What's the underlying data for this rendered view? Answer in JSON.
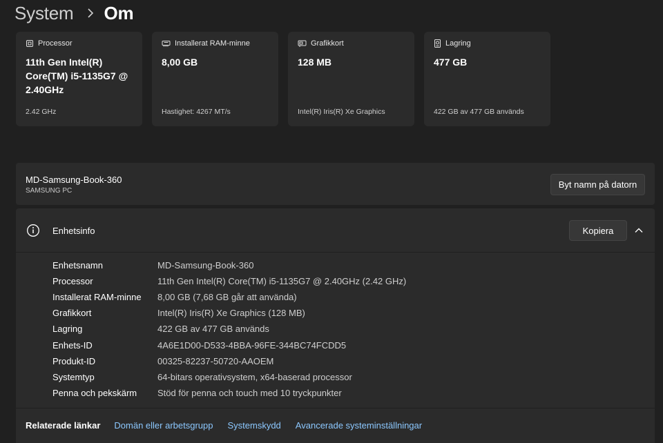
{
  "breadcrumb": {
    "parent": "System",
    "separator_icon": "chevron-right-icon",
    "current": "Om"
  },
  "cards": [
    {
      "title": "Processor",
      "icon": "cpu-icon",
      "value": "11th Gen Intel(R) Core(TM) i5-1135G7 @ 2.40GHz",
      "sub": "2.42 GHz"
    },
    {
      "title": "Installerat RAM-minne",
      "icon": "memory-icon",
      "value": "8,00 GB",
      "sub": "Hastighet: 4267 MT/s"
    },
    {
      "title": "Grafikkort",
      "icon": "gpu-icon",
      "value": "128 MB",
      "sub": "Intel(R) Iris(R) Xe Graphics"
    },
    {
      "title": "Lagring",
      "icon": "storage-icon",
      "value": "477 GB",
      "sub": "422 GB av 477 GB används"
    }
  ],
  "device": {
    "name": "MD-Samsung-Book-360",
    "model": "SAMSUNG PC",
    "rename_label": "Byt namn på datorn"
  },
  "device_info": {
    "title": "Enhetsinfo",
    "icon": "info-icon",
    "copy_label": "Kopiera",
    "collapse_icon": "chevron-up-icon",
    "rows": [
      {
        "label": "Enhetsnamn",
        "value": "MD-Samsung-Book-360"
      },
      {
        "label": "Processor",
        "value": "11th Gen Intel(R) Core(TM) i5-1135G7 @ 2.40GHz (2.42 GHz)"
      },
      {
        "label": "Installerat RAM-minne",
        "value": "8,00 GB (7,68 GB går att använda)"
      },
      {
        "label": "Grafikkort",
        "value": "Intel(R) Iris(R) Xe Graphics (128 MB)"
      },
      {
        "label": "Lagring",
        "value": "422 GB av 477 GB används"
      },
      {
        "label": "Enhets-ID",
        "value": "4A6E1D00-D533-4BBA-96FE-344BC74FCDD5"
      },
      {
        "label": "Produkt-ID",
        "value": "00325-82237-50720-AAOEM"
      },
      {
        "label": "Systemtyp",
        "value": "64-bitars operativsystem, x64-baserad processor"
      },
      {
        "label": "Penna och pekskärm",
        "value": "Stöd för penna och touch med 10 tryckpunkter"
      }
    ]
  },
  "related": {
    "label": "Relaterade länkar",
    "links": [
      "Domän eller arbetsgrupp",
      "Systemskydd",
      "Avancerade systeminställningar"
    ]
  },
  "colors": {
    "background": "#202020",
    "card": "#2b2b2b",
    "link": "#8cc8ff"
  }
}
